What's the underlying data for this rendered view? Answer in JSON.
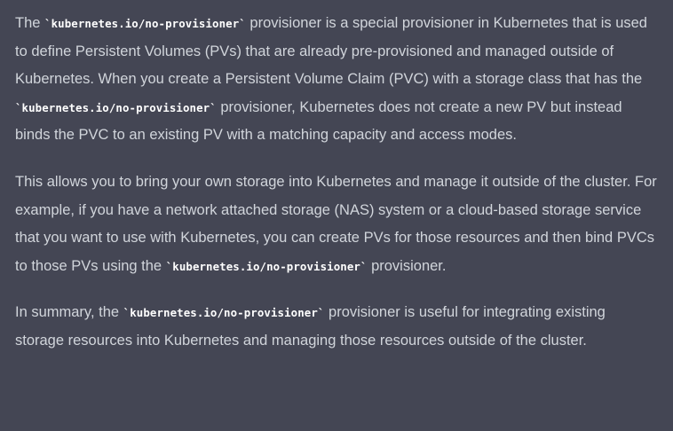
{
  "response": {
    "paragraphs": [
      {
        "segments": [
          "The ",
          "`kubernetes.io/no-provisioner`",
          " provisioner is a special provisioner in Kubernetes that is used to define Persistent Volumes (PVs) that are already pre-provisioned and managed outside of Kubernetes. When you create a Persistent Volume Claim (PVC) with a storage class that has the ",
          "`kubernetes.io/no-provisioner`",
          " provisioner, Kubernetes does not create a new PV but instead binds the PVC to an existing PV with a matching capacity and access modes."
        ]
      },
      {
        "segments": [
          "This allows you to bring your own storage into Kubernetes and manage it outside of the cluster. For example, if you have a network attached storage (NAS) system or a cloud-based storage service that you want to use with Kubernetes, you can create PVs for those resources and then bind PVCs to those PVs using the ",
          "`kubernetes.io/no-provisioner`",
          " provisioner."
        ]
      },
      {
        "segments": [
          "In summary, the ",
          "`kubernetes.io/no-provisioner`",
          " provisioner is useful for integrating existing storage resources into Kubernetes and managing those resources outside of the cluster."
        ]
      }
    ]
  },
  "colors": {
    "background": "#444654",
    "text": "#d1d5db",
    "code": "#ffffff"
  }
}
